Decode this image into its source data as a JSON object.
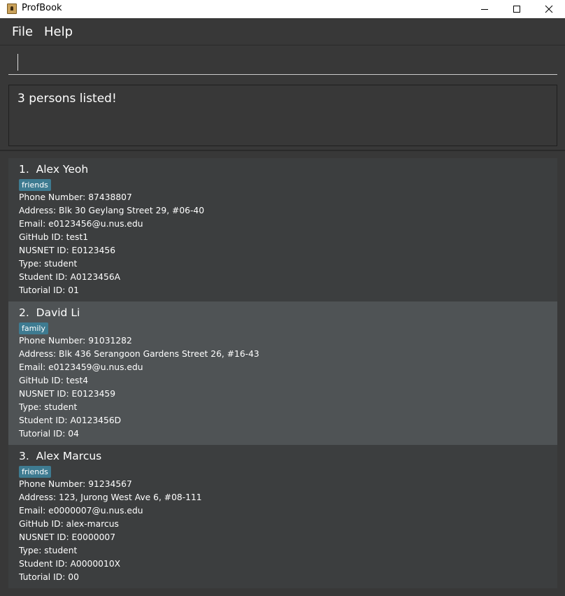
{
  "window": {
    "title": "ProfBook",
    "icons": {
      "app": "address-book-icon",
      "minimize": "minimize-icon",
      "maximize": "maximize-icon",
      "close": "close-icon"
    }
  },
  "menu": {
    "file_label": "File",
    "help_label": "Help"
  },
  "command": {
    "value": "",
    "placeholder": ""
  },
  "result": {
    "message": "3 persons listed!"
  },
  "colors": {
    "background": "#383838",
    "card": "#3c3e3f",
    "card_selected": "#4f5355",
    "tag": "#3e7b91"
  },
  "persons": [
    {
      "index_name": "1.  Alex Yeoh",
      "tag": "friends",
      "phone": "Phone Number: 87438807",
      "address": "Address: Blk 30 Geylang Street 29, #06-40",
      "email": "Email: e0123456@u.nus.edu",
      "github": "GitHub ID: test1",
      "nusnet": "NUSNET ID: E0123456",
      "type": "Type: student",
      "student_id": "Student ID: A0123456A",
      "tutorial": "Tutorial ID: 01"
    },
    {
      "index_name": "2.  David Li",
      "tag": "family",
      "phone": "Phone Number: 91031282",
      "address": "Address: Blk 436 Serangoon Gardens Street 26, #16-43",
      "email": "Email: e0123459@u.nus.edu",
      "github": "GitHub ID: test4",
      "nusnet": "NUSNET ID: E0123459",
      "type": "Type: student",
      "student_id": "Student ID: A0123456D",
      "tutorial": "Tutorial ID: 04"
    },
    {
      "index_name": "3.  Alex Marcus",
      "tag": "friends",
      "phone": "Phone Number: 91234567",
      "address": "Address: 123, Jurong West Ave 6, #08-111",
      "email": "Email: e0000007@u.nus.edu",
      "github": "GitHub ID: alex-marcus",
      "nusnet": "NUSNET ID: E0000007",
      "type": "Type: student",
      "student_id": "Student ID: A0000010X",
      "tutorial": "Tutorial ID: 00"
    }
  ]
}
